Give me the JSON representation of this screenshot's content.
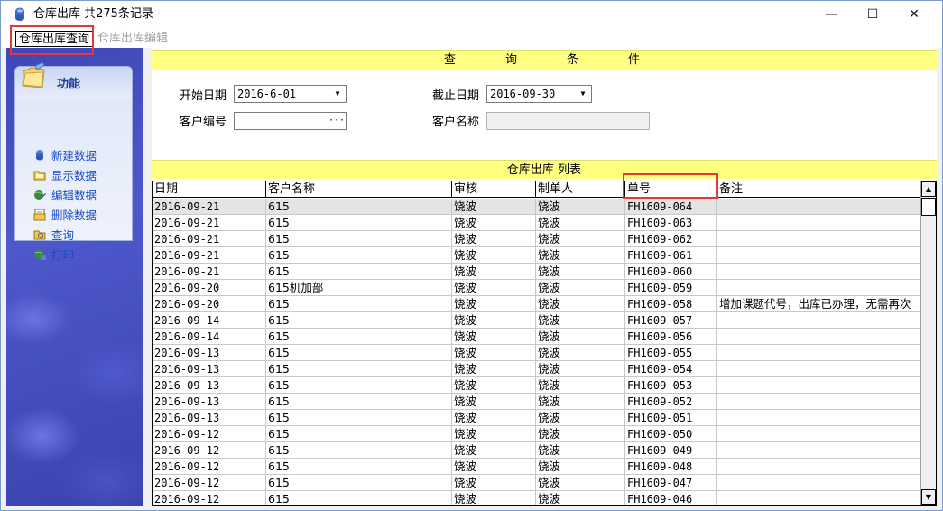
{
  "window": {
    "title": "仓库出库 共275条记录",
    "min_glyph": "—",
    "max_glyph": "☐",
    "close_glyph": "✕"
  },
  "tabs": [
    {
      "label": "仓库出库查询",
      "active": true
    },
    {
      "label": "仓库出库编辑",
      "active": false
    }
  ],
  "sidebar": {
    "title": "功能",
    "items": [
      {
        "label": "新建数据",
        "icon": "new-data-icon"
      },
      {
        "label": "显示数据",
        "icon": "folder-icon"
      },
      {
        "label": "编辑数据",
        "icon": "edit-globe-icon"
      },
      {
        "label": "删除数据",
        "icon": "delete-icon"
      },
      {
        "label": "查询",
        "icon": "search-folder-icon"
      },
      {
        "label": "打印",
        "icon": "print-globe-icon"
      }
    ]
  },
  "query": {
    "header": "查询条件",
    "start_date_label": "开始日期",
    "start_date": "2016-6-01",
    "end_date_label": "截止日期",
    "end_date": "2016-09-30",
    "customer_no_label": "客户编号",
    "customer_no": "",
    "customer_no_button": "···",
    "customer_name_label": "客户名称",
    "customer_name": ""
  },
  "list": {
    "header": "仓库出库 列表",
    "columns": [
      "日期",
      "客户名称",
      "审核",
      "制单人",
      "单号",
      "备注"
    ],
    "rows": [
      [
        "2016-09-21",
        "615",
        "饶波",
        "饶波",
        "FH1609-064",
        ""
      ],
      [
        "2016-09-21",
        "615",
        "饶波",
        "饶波",
        "FH1609-063",
        ""
      ],
      [
        "2016-09-21",
        "615",
        "饶波",
        "饶波",
        "FH1609-062",
        ""
      ],
      [
        "2016-09-21",
        "615",
        "饶波",
        "饶波",
        "FH1609-061",
        ""
      ],
      [
        "2016-09-21",
        "615",
        "饶波",
        "饶波",
        "FH1609-060",
        ""
      ],
      [
        "2016-09-20",
        "615机加部",
        "饶波",
        "饶波",
        "FH1609-059",
        ""
      ],
      [
        "2016-09-20",
        "615",
        "饶波",
        "饶波",
        "FH1609-058",
        "增加课题代号，出库已办理，无需再次"
      ],
      [
        "2016-09-14",
        "615",
        "饶波",
        "饶波",
        "FH1609-057",
        ""
      ],
      [
        "2016-09-14",
        "615",
        "饶波",
        "饶波",
        "FH1609-056",
        ""
      ],
      [
        "2016-09-13",
        "615",
        "饶波",
        "饶波",
        "FH1609-055",
        ""
      ],
      [
        "2016-09-13",
        "615",
        "饶波",
        "饶波",
        "FH1609-054",
        ""
      ],
      [
        "2016-09-13",
        "615",
        "饶波",
        "饶波",
        "FH1609-053",
        ""
      ],
      [
        "2016-09-13",
        "615",
        "饶波",
        "饶波",
        "FH1609-052",
        ""
      ],
      [
        "2016-09-13",
        "615",
        "饶波",
        "饶波",
        "FH1609-051",
        ""
      ],
      [
        "2016-09-12",
        "615",
        "饶波",
        "饶波",
        "FH1609-050",
        ""
      ],
      [
        "2016-09-12",
        "615",
        "饶波",
        "饶波",
        "FH1609-049",
        ""
      ],
      [
        "2016-09-12",
        "615",
        "饶波",
        "饶波",
        "FH1609-048",
        ""
      ],
      [
        "2016-09-12",
        "615",
        "饶波",
        "饶波",
        "FH1609-047",
        ""
      ],
      [
        "2016-09-12",
        "615",
        "饶波",
        "饶波",
        "FH1609-046",
        ""
      ]
    ]
  },
  "colors": {
    "highlight_box": "#e53935",
    "header_yellow": "#ffff80",
    "link_blue": "#1848c8"
  }
}
